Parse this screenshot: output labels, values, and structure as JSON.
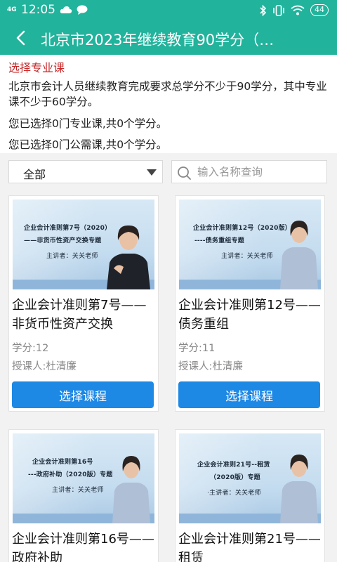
{
  "status_bar": {
    "time": "12:05",
    "signal": "4G",
    "battery": "44",
    "status_icons": [
      "cloud-icon",
      "chat-bubble-icon",
      "bluetooth-icon",
      "vibrate-icon",
      "wifi-icon",
      "battery-icon"
    ]
  },
  "header": {
    "title": "北京市2023年继续教育90学分（…",
    "back_icon": "chevron-left-icon"
  },
  "info": {
    "heading": "选择专业课",
    "description": "北京市会计人员继续教育完成要求总学分不少于90学分，其中专业课不少于60学分。",
    "selected_professional": "您已选择0门专业课,共0个学分。",
    "selected_public": "您已选择0门公需课,共0个学分。"
  },
  "filter": {
    "category_value": "全部",
    "search_placeholder": "输入名称查询"
  },
  "colors": {
    "brand": "#21b39c",
    "button": "#1e88e5",
    "heading": "#c62828"
  },
  "courses": [
    {
      "title": "企业会计准则第7号——非货币性资产交换",
      "credits": "学分:12",
      "lecturer": "授课人:杜清廉",
      "button_label": "选择课程",
      "thumb_lines": [
        "企业会计准则第7号（2020）",
        "——非货币性资产交换专题",
        "主讲者：关关老师"
      ]
    },
    {
      "title": "企业会计准则第12号——债务重组",
      "credits": "学分:11",
      "lecturer": "授课人:杜清廉",
      "button_label": "选择课程",
      "thumb_lines": [
        "企业会计准则第12号（2020版）",
        "----债务重组专题",
        "主讲者：关关老师"
      ]
    },
    {
      "title": "企业会计准则第16号——政府补助",
      "thumb_lines": [
        "企业会计准则第16号",
        "---政府补助（2020版）专题",
        "主讲者：关关老师"
      ]
    },
    {
      "title": "企业会计准则第21号——租赁",
      "thumb_lines": [
        "企业会计准则21号--租赁",
        "（2020版）专题",
        "·主讲者：关关老师"
      ]
    }
  ]
}
